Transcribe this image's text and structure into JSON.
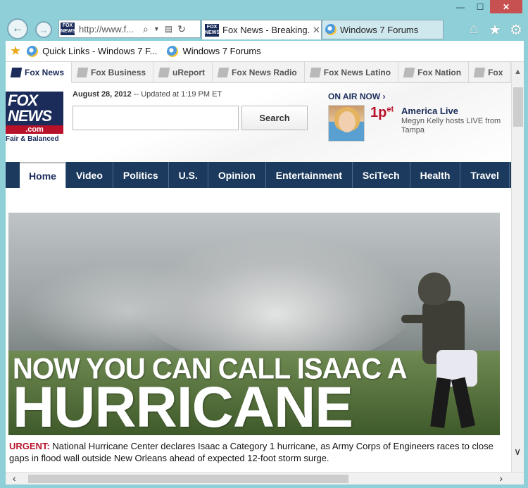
{
  "window": {
    "minimize": "—",
    "maximize": "☐",
    "close": "✕"
  },
  "addressbar": {
    "url": "http://www.f...",
    "favicon": "FOX NEWS"
  },
  "tabs": [
    {
      "label": "Fox News - Breaking...",
      "close": "✕"
    },
    {
      "label": "Windows 7 Forums"
    }
  ],
  "favorites": [
    {
      "label": "Quick Links - Windows 7 F..."
    },
    {
      "label": "Windows 7 Forums"
    }
  ],
  "site_tabs": [
    "Fox News",
    "Fox Business",
    "uReport",
    "Fox News Radio",
    "Fox News Latino",
    "Fox Nation",
    "Fox"
  ],
  "logo": {
    "line1": "FOX",
    "line2": "NEWS",
    "com": ".com",
    "tagline": "Fair & Balanced"
  },
  "header": {
    "date": "August 28, 2012",
    "updated": "-- Updated at 1:19 PM ET",
    "search_button": "Search",
    "search_placeholder": ""
  },
  "onair": {
    "label": "ON AIR NOW ›",
    "time": "1p",
    "time_suffix": "et",
    "show": "America Live",
    "description": "Megyn Kelly hosts LIVE from Tampa"
  },
  "main_nav": [
    "Home",
    "Video",
    "Politics",
    "U.S.",
    "Opinion",
    "Entertainment",
    "SciTech",
    "Health",
    "Travel"
  ],
  "hero": {
    "line1": "NOW YOU CAN CALL ISAAC A",
    "line2": "HURRICANE"
  },
  "caption": {
    "urgent": "URGENT:",
    "text": " National Hurricane Center declares Isaac a Category 1 hurricane, as Army Corps of Engineers races to close gaps in flood wall outside New Orleans ahead of expected 12-foot storm surge."
  },
  "colors": {
    "fox_navy": "#1b2c5a",
    "fox_red": "#b8122a",
    "nav_bg": "#1c3a5e"
  }
}
